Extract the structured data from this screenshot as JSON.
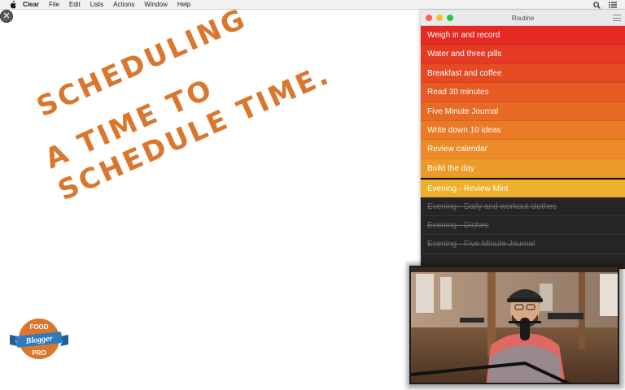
{
  "menubar": {
    "app_name": "Clear",
    "items": [
      "File",
      "Edit",
      "Lists",
      "Actions",
      "Window",
      "Help"
    ]
  },
  "canvas": {
    "close_glyph": "✕",
    "handwriting": [
      "SCHEDULING",
      "A TIME TO",
      "SCHEDULE TIME."
    ],
    "ink_color": "#d9772f"
  },
  "logo": {
    "top": "FOOD",
    "middle": "Blogger",
    "bottom": "PRO",
    "circle_color": "#d9772f",
    "ribbon_color": "#2f7bbf"
  },
  "window": {
    "title": "Routine",
    "tasks": [
      {
        "label": "Weigh in and record",
        "color": "#e42a22",
        "done": false
      },
      {
        "label": "Water and three pills",
        "color": "#e53a23",
        "done": false
      },
      {
        "label": "Breakfast and coffee",
        "color": "#e64a23",
        "done": false
      },
      {
        "label": "Read 30 minutes",
        "color": "#e75a24",
        "done": false
      },
      {
        "label": "Five Minute Journal",
        "color": "#e86a25",
        "done": false
      },
      {
        "label": "Write down 10 ideas",
        "color": "#ea7a26",
        "done": false
      },
      {
        "label": "Review calendar",
        "color": "#eb8a27",
        "done": false
      },
      {
        "label": "Build the day",
        "color": "#ec9a28",
        "done": false
      },
      {
        "label": "Evening - Review Mint",
        "color": "#eeb02a",
        "done": false
      },
      {
        "label": "Evening - Daily and workout clothes",
        "color": "#252525",
        "done": true
      },
      {
        "label": "Evening - Dishes",
        "color": "#252525",
        "done": true
      },
      {
        "label": "Evening - Five Minute Journal",
        "color": "#252525",
        "done": true
      }
    ]
  },
  "icons": {
    "apple": "apple-icon",
    "search": "search-icon",
    "list": "list-icon",
    "menu": "menu-icon"
  }
}
